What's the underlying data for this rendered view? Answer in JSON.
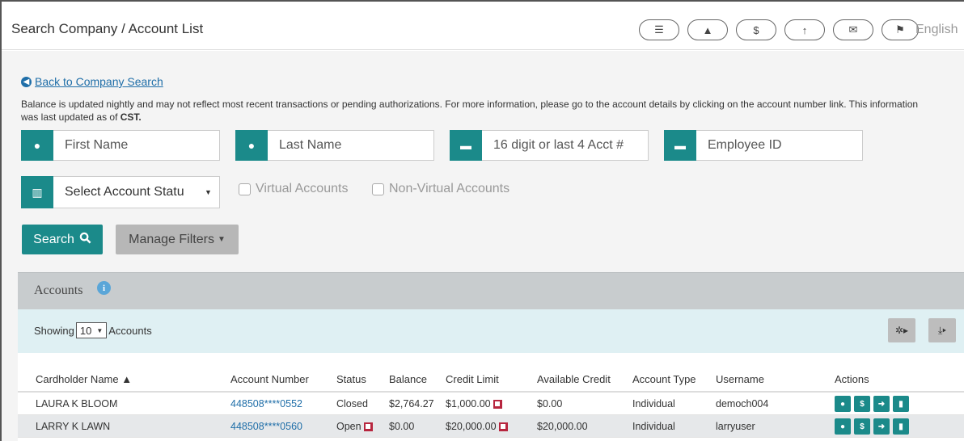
{
  "topbar": {
    "breadcrumb": "Search Company / Account List",
    "icons": [
      "checklist-icon",
      "bell-icon",
      "dollar-icon",
      "upload-icon",
      "mail-icon",
      "flag-icon"
    ],
    "language": "English"
  },
  "back_link": "Back to Company Search",
  "notice": {
    "text": "Balance is updated nightly and may not reflect most recent transactions or pending authorizations. For more information, please go to the account details by clicking on the account number link. This information was last updated as of",
    "tz": "CST."
  },
  "filters": {
    "first_name_placeholder": "First Name",
    "last_name_placeholder": "Last Name",
    "account_placeholder": "16 digit or last 4 Acct #",
    "employee_placeholder": "Employee ID",
    "status_select": "Select Account Statu",
    "virtual_label": "Virtual Accounts",
    "non_virtual_label": "Non-Virtual Accounts"
  },
  "buttons": {
    "search": "Search",
    "manage_filters": "Manage Filters"
  },
  "panel": {
    "title": "Accounts",
    "showing_label": "Showing",
    "page_size": "10",
    "accounts_label": "Accounts"
  },
  "table": {
    "headers": [
      "Cardholder Name ▲",
      "Account Number",
      "Status",
      "Balance",
      "Credit Limit",
      "Available Credit",
      "Account Type",
      "Username",
      "Actions"
    ],
    "rows": [
      {
        "name": "LAURA K BLOOM",
        "account": "448508****0552",
        "status": "Closed",
        "balance": "$2,764.27",
        "credit_limit": "$1,000.00",
        "available": "$0.00",
        "type": "Individual",
        "username": "democh004"
      },
      {
        "name": "LARRY K LAWN",
        "account": "448508****0560",
        "status": "Open",
        "balance": "$0.00",
        "credit_limit": "$20,000.00",
        "available": "$20,000.00",
        "type": "Individual",
        "username": "larryuser"
      }
    ]
  },
  "colors": {
    "accent": "#1b8a8a",
    "link": "#1f6ea8",
    "edit": "#b7263f"
  }
}
